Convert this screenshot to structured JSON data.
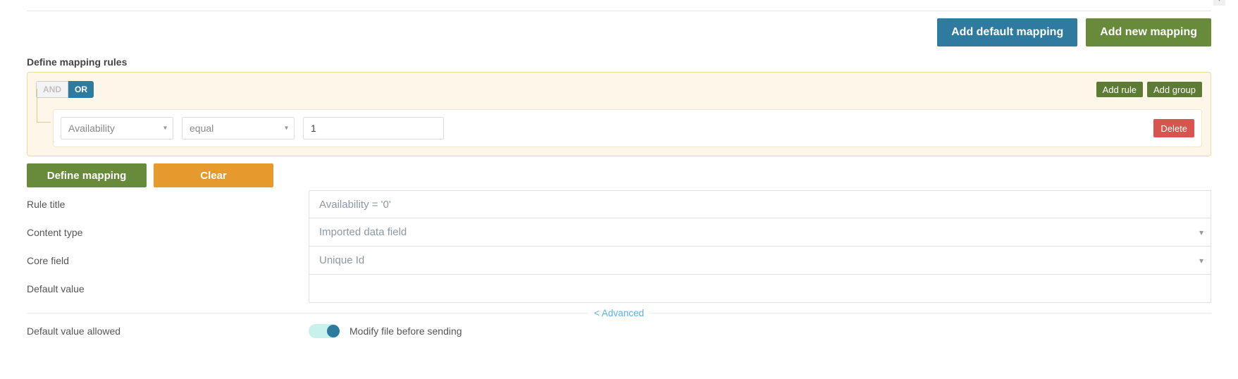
{
  "top": {
    "add_default_mapping": "Add default mapping",
    "add_new_mapping": "Add new mapping"
  },
  "section_title": "Define mapping rules",
  "rules": {
    "and": "AND",
    "or": "OR",
    "add_rule": "Add rule",
    "add_group": "Add group",
    "field_select": "Availability",
    "operator_select": "equal",
    "value_input": "1",
    "delete": "Delete"
  },
  "mid": {
    "define_mapping": "Define mapping",
    "clear": "Clear"
  },
  "form": {
    "rule_title_label": "Rule title",
    "rule_title_value": "Availability = '0'",
    "content_type_label": "Content type",
    "content_type_value": "Imported data field",
    "core_field_label": "Core field",
    "core_field_value": "Unique Id",
    "default_value_label": "Default value",
    "default_value_value": ""
  },
  "advanced": "< Advanced",
  "toggle": {
    "label": "Default value allowed",
    "text": "Modify file before sending"
  }
}
